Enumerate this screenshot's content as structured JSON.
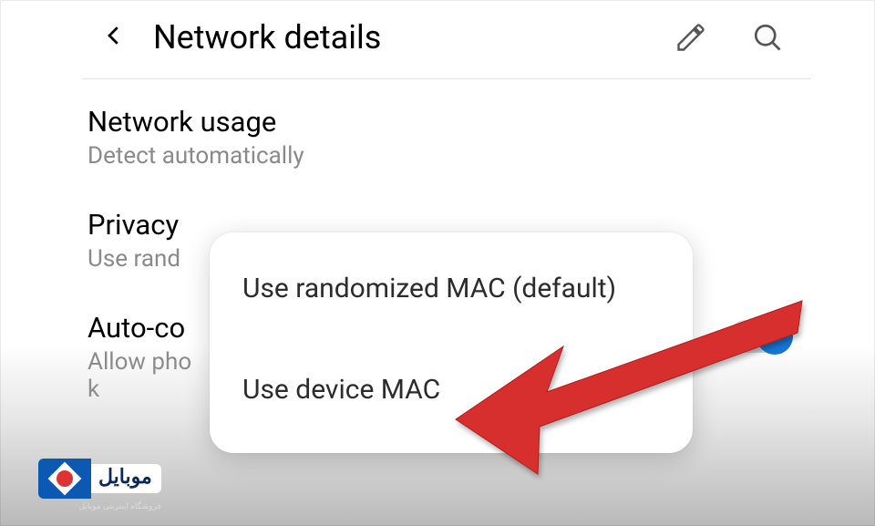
{
  "header": {
    "title": "Network details"
  },
  "settings": {
    "network_usage": {
      "label": "Network usage",
      "sub": "Detect automatically"
    },
    "privacy": {
      "label": "Privacy",
      "sub": "Use rand"
    },
    "auto_connect": {
      "label": "Auto-co",
      "sub1": "Allow pho",
      "sub2": "k"
    }
  },
  "popup": {
    "option1": "Use randomized MAC (default)",
    "option2": "Use device MAC"
  },
  "watermark": {
    "brand": "موبایل",
    "tagline": "فروشگاه اینترنتی موبایل"
  }
}
